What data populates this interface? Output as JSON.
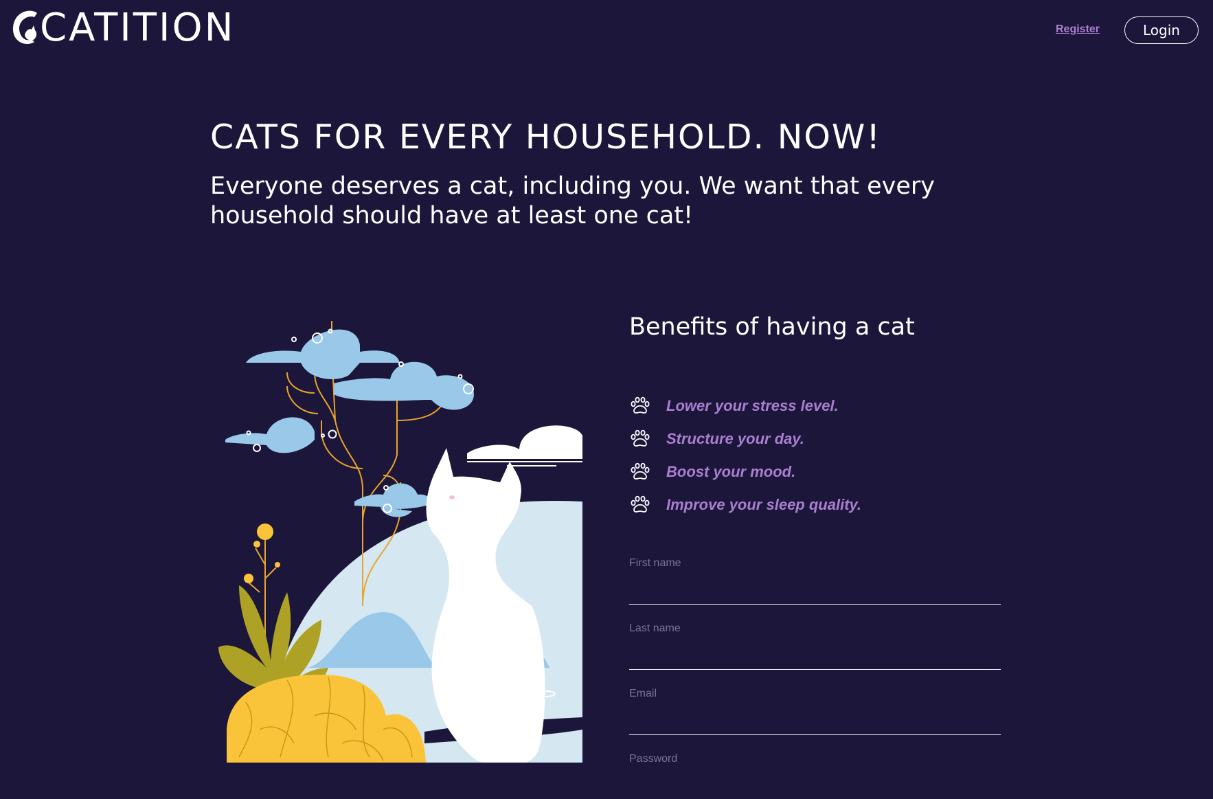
{
  "header": {
    "logo_text": "CATITION",
    "register_label": "Register",
    "login_label": "Login"
  },
  "hero": {
    "title": "CATS FOR EVERY HOUSEHOLD. NOW!",
    "subtitle": "Everyone deserves a cat, including you. We want that every household should have at least one cat!"
  },
  "benefits": {
    "title": "Benefits of having a cat",
    "items": [
      {
        "icon": "paw-icon",
        "label": "Lower your stress level."
      },
      {
        "icon": "paw-icon",
        "label": "Structure your day."
      },
      {
        "icon": "paw-icon",
        "label": "Boost your mood."
      },
      {
        "icon": "paw-icon",
        "label": "Improve your sleep quality."
      }
    ]
  },
  "form": {
    "fields": [
      {
        "label": "First name",
        "value": ""
      },
      {
        "label": "Last name",
        "value": ""
      },
      {
        "label": "Email",
        "value": ""
      },
      {
        "label": "Password",
        "value": ""
      }
    ]
  },
  "colors": {
    "background": "#1c163b",
    "accent_purple": "#a97fcf",
    "cloud_blue": "#9ac8e8",
    "hill_light": "#d5e8f1",
    "yellow": "#fac43a",
    "olive": "#ada225",
    "branch_orange": "#e8a52a"
  }
}
